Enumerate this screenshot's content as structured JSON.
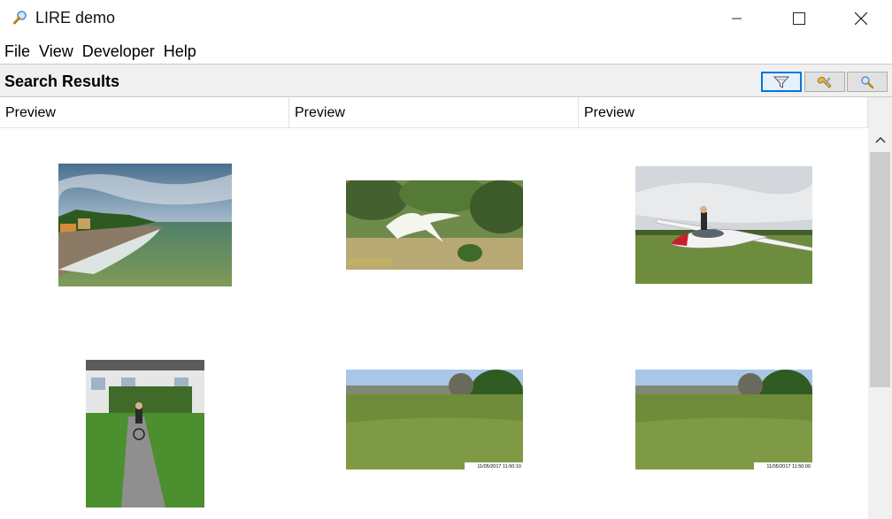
{
  "window": {
    "title": "LIRE demo",
    "icon": "magnifier-icon"
  },
  "menu": {
    "items": [
      "File",
      "View",
      "Developer",
      "Help"
    ]
  },
  "toolbar": {
    "title": "Search Results",
    "buttons": [
      {
        "name": "filter-button",
        "icon": "filter-funnel-icon",
        "active": true
      },
      {
        "name": "tools-button",
        "icon": "wrench-icon",
        "active": false
      },
      {
        "name": "search-button",
        "icon": "magnifier-icon",
        "active": false
      }
    ]
  },
  "table": {
    "columns": [
      "Preview",
      "Preview",
      "Preview"
    ],
    "rows": [
      [
        "coast-sea-photo",
        "swan-in-flight-photo",
        "glider-on-field-photo"
      ],
      [
        "houses-cyclist-photo",
        "meadow-trees-photo",
        "meadow-trees-photo"
      ]
    ],
    "timestamps": [
      "11/05/2017 11:50:10",
      "11/05/2017 11:50:00"
    ]
  }
}
